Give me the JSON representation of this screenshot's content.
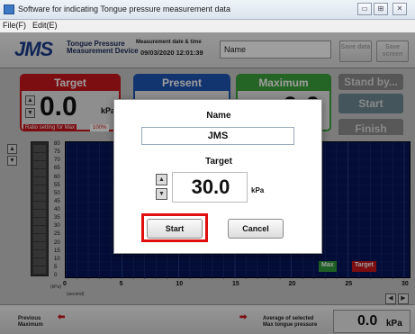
{
  "window": {
    "title": "Software for indicating Tongue pressure measurement data",
    "controls": [
      "▭",
      "⊞",
      "✕"
    ]
  },
  "menu": {
    "items": [
      "File(F)",
      "Edit(E)"
    ]
  },
  "header": {
    "logo": "JMS",
    "device_line1": "Tongue Pressure",
    "device_line2": "Measurement Device",
    "datetime_label": "Measurement date & time",
    "datetime_value": "09/03/2020 12:01:39",
    "name_value": "Name",
    "save_data_label": "Save data",
    "save_screen_label": "Save screen"
  },
  "panels": {
    "target_title": "Target",
    "target_value": "0.0",
    "target_unit": "kPa",
    "ratio_label": "Ratio setting for Max",
    "ratio_value": "100%",
    "present_title": "Present",
    "maximum_title": "Maximum",
    "maximum_value": "0.0"
  },
  "side": {
    "standby_label": "Stand by...",
    "start_label": "Start",
    "finish_label": "Finish"
  },
  "chart": {
    "y_ticks": [
      "80",
      "75",
      "70",
      "65",
      "60",
      "55",
      "50",
      "45",
      "40",
      "35",
      "30",
      "25",
      "20",
      "15",
      "10",
      "5",
      "0"
    ],
    "x_ticks": [
      "0",
      "5",
      "10",
      "15",
      "20",
      "25",
      "30"
    ],
    "y_unit": "(kPa)",
    "x_unit": "(second)",
    "max_marker": "Max",
    "target_marker": "Target",
    "nav_left": "◀",
    "nav_right": "▶"
  },
  "bottom": {
    "prev_max_line1": "Previous",
    "prev_max_line2": "Maximum",
    "avg_line1": "Average of selected",
    "avg_line2": "Max tongue pressure",
    "avg_value": "0.0",
    "avg_unit": "kPa"
  },
  "dialog": {
    "name_label": "Name",
    "name_value": "JMS",
    "target_label": "Target",
    "target_value": "30.0",
    "target_unit": "kPa",
    "start_label": "Start",
    "cancel_label": "Cancel"
  },
  "colors": {
    "target": "#c8171d",
    "present": "#1d56b3",
    "maximum": "#3aa23a",
    "plot_bg": "#07165a",
    "highlight": "#e01010"
  }
}
